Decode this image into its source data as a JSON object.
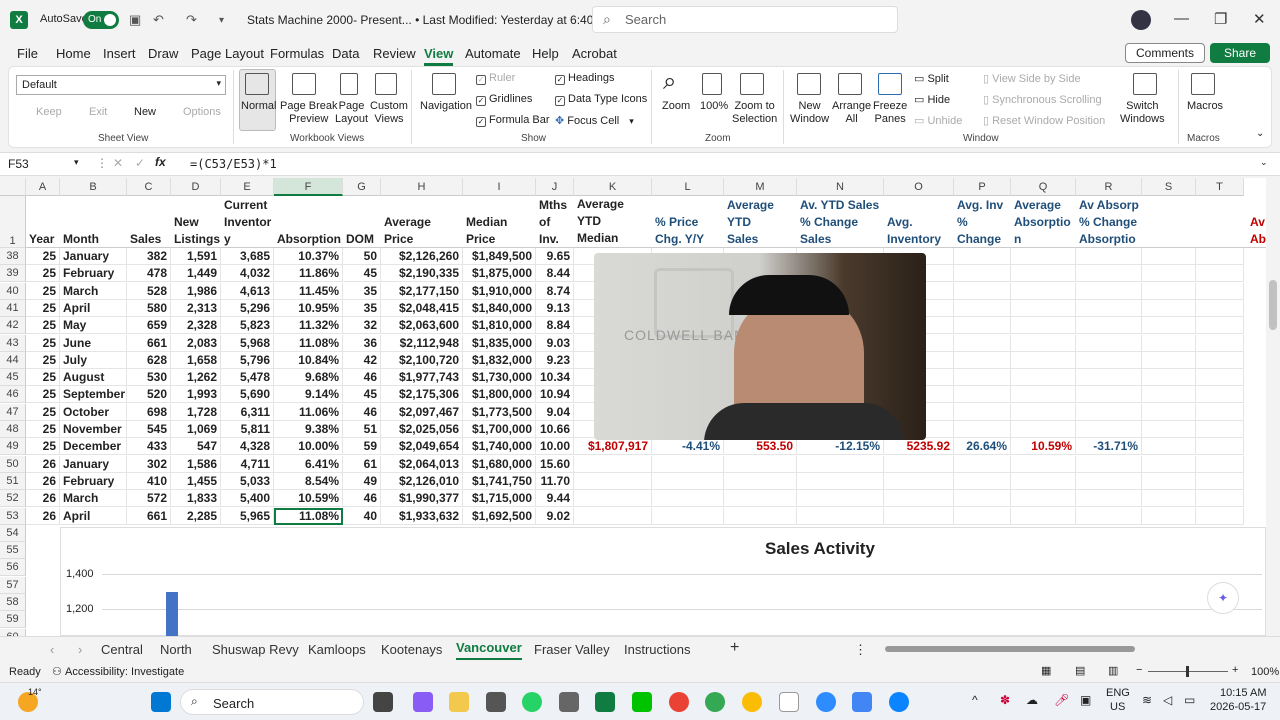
{
  "titlebar": {
    "autosave_label": "AutoSave",
    "autosave_state": "On",
    "doc_title": "Stats Machine 2000- Present... • Last Modified: Yesterday at 6:40 AM",
    "search_placeholder": "Search"
  },
  "menu": [
    "File",
    "Home",
    "Insert",
    "Draw",
    "Page Layout",
    "Formulas",
    "Data",
    "Review",
    "View",
    "Automate",
    "Help",
    "Acrobat"
  ],
  "menu_active": "View",
  "buttons": {
    "comments": "Comments",
    "share": "Share"
  },
  "ribbon": {
    "sheet_view": {
      "dropdown": "Default",
      "keep": "Keep",
      "exit": "Exit",
      "new": "New",
      "options": "Options",
      "group": "Sheet View"
    },
    "workbook_views": {
      "normal": "Normal",
      "page_break": "Page Break\nPreview",
      "page_layout": "Page\nLayout",
      "custom": "Custom\nViews",
      "group": "Workbook Views"
    },
    "show": {
      "navigation": "Navigation",
      "ruler": "Ruler",
      "gridlines": "Gridlines",
      "formula_bar": "Formula Bar",
      "headings": "Headings",
      "data_type_icons": "Data Type Icons",
      "focus_cell": "Focus Cell",
      "group": "Show"
    },
    "zoom": {
      "zoom": "Zoom",
      "zoom100": "100%",
      "zoom_selection": "Zoom to\nSelection",
      "group": "Zoom"
    },
    "window": {
      "new_window": "New\nWindow",
      "arrange_all": "Arrange\nAll",
      "freeze_panes": "Freeze\nPanes",
      "split": "Split",
      "hide": "Hide",
      "unhide": "Unhide",
      "side_by_side": "View Side by Side",
      "sync_scroll": "Synchronous Scrolling",
      "reset_pos": "Reset Window Position",
      "switch": "Switch\nWindows",
      "group": "Window"
    },
    "macros": {
      "macros": "Macros",
      "group": "Macros"
    }
  },
  "formula_bar": {
    "name_box": "F53",
    "formula": "=(C53/E53)*1"
  },
  "columns": [
    "A",
    "B",
    "C",
    "D",
    "E",
    "F",
    "G",
    "H",
    "I",
    "J",
    "K",
    "L",
    "M",
    "N",
    "O",
    "P",
    "Q",
    "R",
    "S",
    "T"
  ],
  "header_row": {
    "A": "Year",
    "B": "Month",
    "C": "Sales",
    "D": "New\nListings",
    "E": "Current\nInventor\ny",
    "F": "Absorption",
    "G": "DOM",
    "H": "Average\nPrice",
    "I": "Median\nPrice",
    "J": "Mths\nof\nInv.",
    "K": "Average YTD\nMedian Price",
    "L": "% Price\nChg. Y/Y",
    "M": "Average\nYTD\nSales",
    "N": "Av. YTD Sales\n% Change\nSales",
    "O": "Avg.\nInventory",
    "P": "Avg. Inv\n%\nChange",
    "Q": "Average\nAbsorptio\nn",
    "R": "Av Absorp\n% Change\nAbsorptio",
    "U": "Av\nAb"
  },
  "rows": [
    {
      "n": "38",
      "c": [
        "25",
        "January",
        "382",
        "1,591",
        "3,685",
        "10.37%",
        "50",
        "$2,126,260",
        "$1,849,500",
        "9.65"
      ]
    },
    {
      "n": "39",
      "c": [
        "25",
        "February",
        "478",
        "1,449",
        "4,032",
        "11.86%",
        "45",
        "$2,190,335",
        "$1,875,000",
        "8.44"
      ]
    },
    {
      "n": "40",
      "c": [
        "25",
        "March",
        "528",
        "1,986",
        "4,613",
        "11.45%",
        "35",
        "$2,177,150",
        "$1,910,000",
        "8.74"
      ]
    },
    {
      "n": "41",
      "c": [
        "25",
        "April",
        "580",
        "2,313",
        "5,296",
        "10.95%",
        "35",
        "$2,048,415",
        "$1,840,000",
        "9.13"
      ]
    },
    {
      "n": "42",
      "c": [
        "25",
        "May",
        "659",
        "2,328",
        "5,823",
        "11.32%",
        "32",
        "$2,063,600",
        "$1,810,000",
        "8.84"
      ]
    },
    {
      "n": "43",
      "c": [
        "25",
        "June",
        "661",
        "2,083",
        "5,968",
        "11.08%",
        "36",
        "$2,112,948",
        "$1,835,000",
        "9.03"
      ]
    },
    {
      "n": "44",
      "c": [
        "25",
        "July",
        "628",
        "1,658",
        "5,796",
        "10.84%",
        "42",
        "$2,100,720",
        "$1,832,000",
        "9.23"
      ]
    },
    {
      "n": "45",
      "c": [
        "25",
        "August",
        "530",
        "1,262",
        "5,478",
        "9.68%",
        "46",
        "$1,977,743",
        "$1,730,000",
        "10.34"
      ]
    },
    {
      "n": "46",
      "c": [
        "25",
        "September",
        "520",
        "1,993",
        "5,690",
        "9.14%",
        "45",
        "$2,175,306",
        "$1,800,000",
        "10.94"
      ]
    },
    {
      "n": "47",
      "c": [
        "25",
        "October",
        "698",
        "1,728",
        "6,311",
        "11.06%",
        "46",
        "$2,097,467",
        "$1,773,500",
        "9.04"
      ]
    },
    {
      "n": "48",
      "c": [
        "25",
        "November",
        "545",
        "1,069",
        "5,811",
        "9.38%",
        "51",
        "$2,025,056",
        "$1,700,000",
        "10.66"
      ]
    },
    {
      "n": "49",
      "c": [
        "25",
        "December",
        "433",
        "547",
        "4,328",
        "10.00%",
        "59",
        "$2,049,654",
        "$1,740,000",
        "10.00"
      ],
      "extra": [
        "$1,807,917",
        "-4.41%",
        "553.50",
        "-12.15%",
        "5235.92",
        "26.64%",
        "10.59%",
        "-31.71%"
      ]
    },
    {
      "n": "50",
      "c": [
        "26",
        "January",
        "302",
        "1,586",
        "4,711",
        "6.41%",
        "61",
        "$2,064,013",
        "$1,680,000",
        "15.60"
      ]
    },
    {
      "n": "51",
      "c": [
        "26",
        "February",
        "410",
        "1,455",
        "5,033",
        "8.54%",
        "49",
        "$2,126,010",
        "$1,741,750",
        "11.70"
      ]
    },
    {
      "n": "52",
      "c": [
        "26",
        "March",
        "572",
        "1,833",
        "5,400",
        "10.59%",
        "46",
        "$1,990,377",
        "$1,715,000",
        "9.44"
      ]
    },
    {
      "n": "53",
      "c": [
        "26",
        "April",
        "661",
        "2,285",
        "5,965",
        "11.08%",
        "40",
        "$1,933,632",
        "$1,692,500",
        "9.02"
      ]
    }
  ],
  "extra_rows": [
    "54",
    "55",
    "56",
    "57",
    "58",
    "59",
    "60"
  ],
  "chart_data": {
    "type": "bar",
    "title": "Sales Activity",
    "y_ticks": [
      "1,400",
      "1,200"
    ],
    "values": [
      1300
    ]
  },
  "sheet_tabs": [
    "Central",
    "North",
    "Shuswap Revy",
    "Kamloops",
    "Kootenays",
    "Vancouver",
    "Fraser Valley",
    "Instructions"
  ],
  "sheet_active": "Vancouver",
  "status": {
    "ready": "Ready",
    "accessibility": "Accessibility: Investigate",
    "zoom": "100%"
  },
  "taskbar": {
    "weather": "14°",
    "search": "Search",
    "lang1": "ENG",
    "lang2": "US",
    "time": "10:15 AM",
    "date": "2026-05-17"
  },
  "video": {
    "logo_text": "COLDWELL BAN"
  },
  "colors": {
    "excel_green": "#107c41",
    "red": "#c00000",
    "blue": "#1f4e79"
  }
}
